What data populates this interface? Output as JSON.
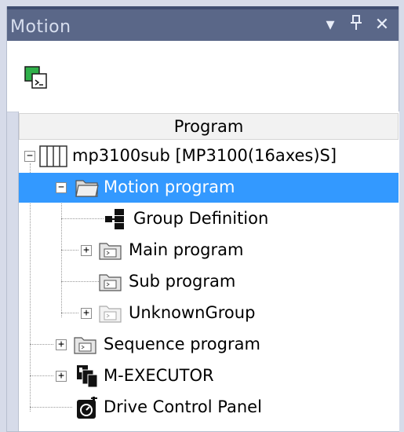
{
  "panel": {
    "title": "Motion",
    "pin_glyph": "٩",
    "close_glyph": "✕",
    "dropdown_glyph": "▾"
  },
  "tree": {
    "column_header": "Program",
    "items": [
      {
        "label": "mp3100sub  [MP3100(16axes)S]",
        "icon": "controller-icon",
        "expander": "−",
        "selected": false
      },
      {
        "label": "Motion program",
        "icon": "open-folder-icon",
        "expander": "−",
        "selected": true
      },
      {
        "label": "Group Definition",
        "icon": "group-definition-icon",
        "expander": "",
        "selected": false
      },
      {
        "label": "Main program",
        "icon": "program-folder-icon",
        "expander": "+",
        "selected": false
      },
      {
        "label": "Sub program",
        "icon": "program-folder-icon",
        "expander": "",
        "selected": false
      },
      {
        "label": "UnknownGroup",
        "icon": "disabled-folder-icon",
        "expander": "+",
        "selected": false
      },
      {
        "label": "Sequence program",
        "icon": "program-folder-icon",
        "expander": "+",
        "selected": false
      },
      {
        "label": "M-EXECUTOR",
        "icon": "executor-icon",
        "expander": "+",
        "selected": false
      },
      {
        "label": "Drive Control Panel",
        "icon": "drive-control-panel-icon",
        "expander": "",
        "selected": false
      }
    ]
  },
  "colors": {
    "title_bar": "#5a6788",
    "selection": "#3399ff",
    "background": "#d6dbe9"
  }
}
